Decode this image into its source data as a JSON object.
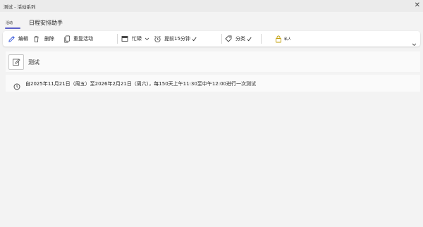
{
  "window": {
    "title": "测试 - 活动系列",
    "close_glyph": "✕"
  },
  "tabs": [
    {
      "label": "活动",
      "active": true
    },
    {
      "label": "日程安排助手",
      "active": false
    }
  ],
  "ribbon": {
    "edit_label": "编辑",
    "delete_label": "删除",
    "repeat_label": "重复活动",
    "status_label": "忙碌",
    "reminder_label": "提前15分钟",
    "category_label": "分类",
    "private_label": "私人",
    "icons": [
      "pencil-icon",
      "trash-icon",
      "copy-icon",
      "busy-icon",
      "chevron-down-icon",
      "alarm-icon",
      "check-icon",
      "tag-icon",
      "lock-icon"
    ]
  },
  "event": {
    "title": "测试",
    "recurrence": "自2025年11月21日（周五）至2026年2月21日（周六），每150天上午11:30至中午12:00进行一次测试"
  },
  "colors": {
    "accent": "#5b5fc7",
    "background": "#f3f3f3",
    "card": "#fafafa",
    "private": "#c19c00"
  }
}
